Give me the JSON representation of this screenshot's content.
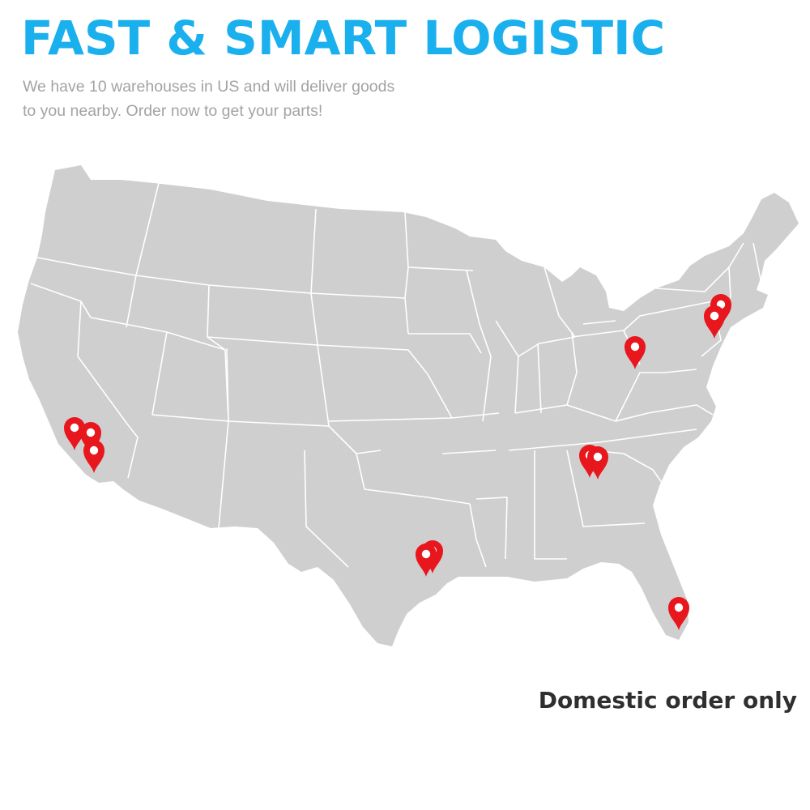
{
  "header": {
    "title": "FAST & SMART LOGISTIC",
    "subtitle_line1": "We have 10 warehouses in US and will deliver goods",
    "subtitle_line2": "to you nearby. Order now to get your parts!"
  },
  "map": {
    "region": "United States",
    "land_color": "#cfcfcf",
    "border_color": "#ffffff",
    "marker_color": "#e8161d",
    "marker_icon": "map-pin-icon",
    "warehouse_groups": [
      {
        "area": "Southern California",
        "pins": 3
      },
      {
        "area": "Houston, Texas",
        "pins": 2
      },
      {
        "area": "Atlanta, Georgia",
        "pins": 2
      },
      {
        "area": "Miami, Florida",
        "pins": 1
      },
      {
        "area": "Ohio / Pennsylvania",
        "pins": 1
      },
      {
        "area": "New York / New Jersey",
        "pins": 2
      }
    ]
  },
  "footer": {
    "note": "Domestic order only"
  }
}
